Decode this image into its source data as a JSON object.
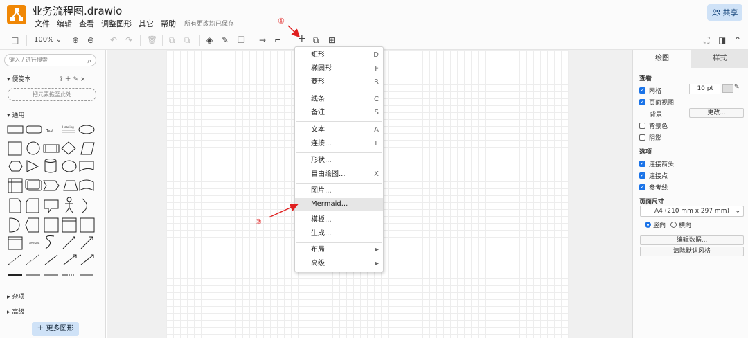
{
  "header": {
    "title": "业务流程图.drawio",
    "menu": [
      "文件",
      "编辑",
      "查看",
      "调整图形",
      "其它",
      "帮助"
    ],
    "save_status": "所有更改均已保存",
    "share_label": "共享"
  },
  "toolbar": {
    "zoom": "100%"
  },
  "left_panel": {
    "search_placeholder": "键入 / 进行搜索",
    "scratchpad_title": "便笺本",
    "drop_hint": "把元素拖至此处",
    "general_title": "通用",
    "misc_title": "杂项",
    "advanced_title": "高级",
    "more_shapes": "更多图形"
  },
  "insert_menu": {
    "items": [
      {
        "label": "矩形",
        "key": "D"
      },
      {
        "label": "椭圆形",
        "key": "F"
      },
      {
        "label": "菱形",
        "key": "R"
      },
      {
        "label": "线条",
        "key": "C"
      },
      {
        "label": "备注",
        "key": "S"
      },
      {
        "label": "文本",
        "key": "A"
      },
      {
        "label": "连接...",
        "key": "L"
      },
      {
        "label": "形状...",
        "key": ""
      },
      {
        "label": "自由绘图...",
        "key": "X"
      },
      {
        "label": "图片...",
        "key": ""
      },
      {
        "label": "Mermaid...",
        "key": ""
      },
      {
        "label": "模板...",
        "key": ""
      },
      {
        "label": "生成...",
        "key": ""
      },
      {
        "label": "布局",
        "key": "▸"
      },
      {
        "label": "高级",
        "key": "▸"
      }
    ]
  },
  "annotations": [
    "①",
    "②"
  ],
  "right_panel": {
    "tabs": [
      "绘图",
      "样式"
    ],
    "view_title": "查看",
    "grid": "网格",
    "grid_size": "10 pt",
    "page_view": "页面视图",
    "background": "背景",
    "change_btn": "更改...",
    "bg_color": "背景色",
    "shadow": "阴影",
    "options_title": "选项",
    "conn_arrows": "连接箭头",
    "conn_points": "连接点",
    "guides": "参考线",
    "paper_title": "页面尺寸",
    "paper_size": "A4 (210 mm x 297 mm)",
    "portrait": "竖向",
    "landscape": "横向",
    "edit_data": "编辑数据...",
    "clear_style": "清除默认风格"
  }
}
